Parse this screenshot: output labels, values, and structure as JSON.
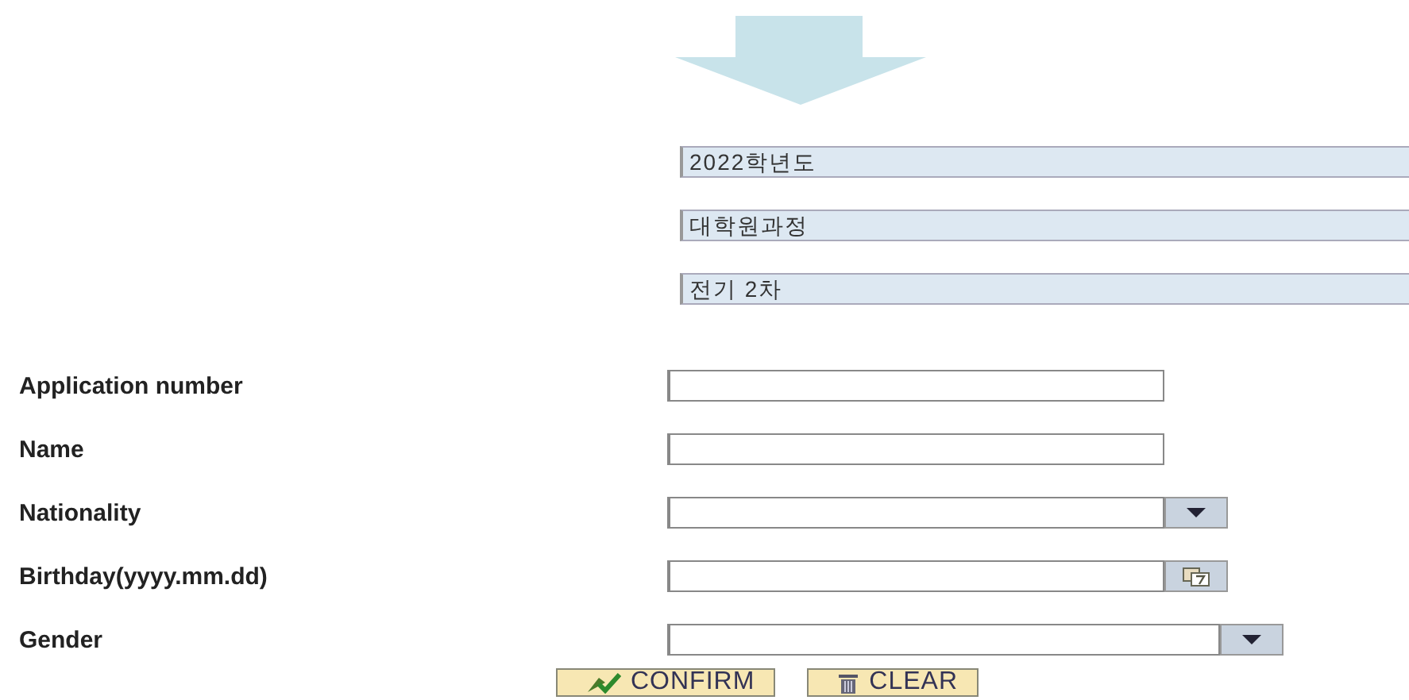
{
  "selection_fields": [
    {
      "value": "2022학년도"
    },
    {
      "value": "대학원과정"
    },
    {
      "value": "전기 2차"
    }
  ],
  "form": [
    {
      "label": "Application number",
      "kind": "text"
    },
    {
      "label": "Name",
      "kind": "text"
    },
    {
      "label": "Nationality",
      "kind": "select"
    },
    {
      "label": "Birthday(yyyy.mm.dd)",
      "kind": "date"
    },
    {
      "label": "Gender",
      "kind": "select-wide"
    }
  ],
  "buttons": [
    {
      "label": "CONFIRM",
      "kind": "confirm"
    },
    {
      "label": "CLEAR",
      "kind": "clear"
    }
  ]
}
